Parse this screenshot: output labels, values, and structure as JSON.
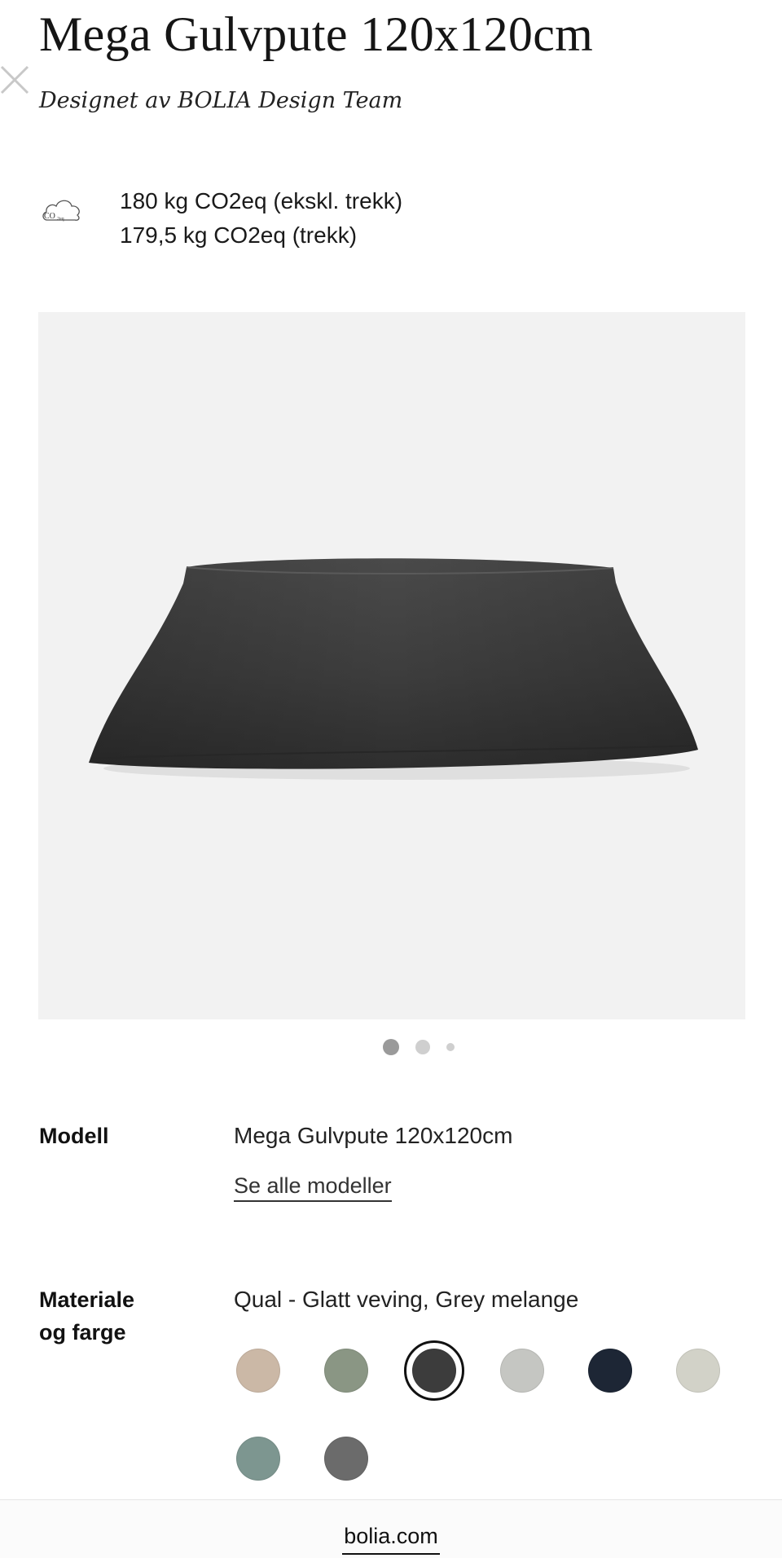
{
  "product": {
    "title": "Mega Gulvpute 120x120cm",
    "designer": "Designet av BOLIA Design Team"
  },
  "co2": {
    "icon": "co2-cloud-icon",
    "icon_text": "CO",
    "icon_sub": "2eq",
    "line1": "180 kg CO2eq (ekskl. trekk)",
    "line2": "179,5 kg CO2eq (trekk)"
  },
  "gallery": {
    "image": "floor-cushion-image",
    "pages": 3,
    "current_page": 1
  },
  "model": {
    "label": "Modell",
    "value": "Mega Gulvpute 120x120cm",
    "link": "Se alle modeller"
  },
  "material": {
    "label_line1": "Materiale",
    "label_line2": "og farge",
    "value": "Qual - Glatt veving, Grey melange",
    "swatches": [
      {
        "color": "#cbb8a6",
        "selected": false
      },
      {
        "color": "#8a9684",
        "selected": false
      },
      {
        "color": "#3c3c3c",
        "selected": true
      },
      {
        "color": "#c5c6c2",
        "selected": false
      },
      {
        "color": "#1d2635",
        "selected": false
      },
      {
        "color": "#d2d2c8",
        "selected": false
      },
      {
        "color": "#7d9690",
        "selected": false
      },
      {
        "color": "#6b6b6b",
        "selected": false
      }
    ]
  },
  "footer": {
    "url": "bolia.com"
  }
}
